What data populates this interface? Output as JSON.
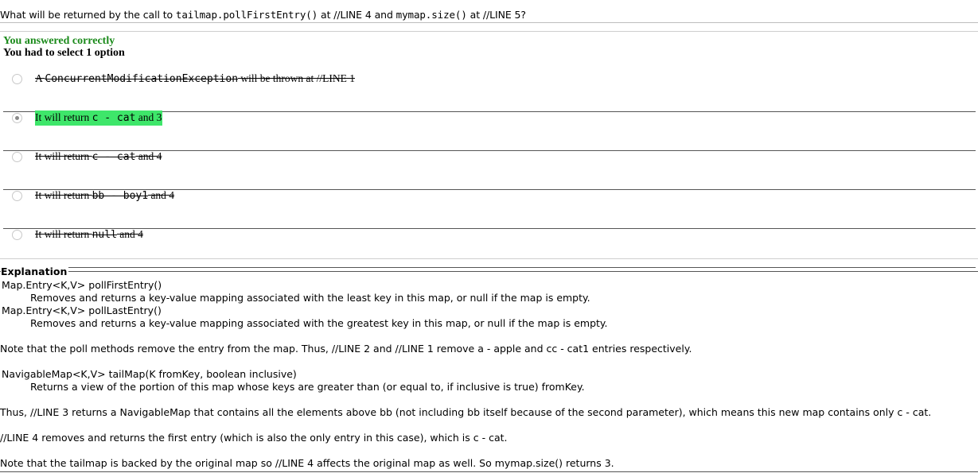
{
  "question": {
    "pre": "What will be returned by the call to ",
    "code1": "tailmap.pollFirstEntry()",
    "mid": " at //LINE 4 and ",
    "code2": "mymap.size()",
    "post": " at //LINE 5?"
  },
  "result": {
    "status": "You answered correctly",
    "instruction": "You had to select 1 option"
  },
  "options": [
    {
      "pre": "A ",
      "code": "ConcurrentModificationException",
      "post": " will be thrown at //LINE 1",
      "selected": false
    },
    {
      "pre": "It will return ",
      "code": "c - cat",
      "post": " and 3",
      "selected": true
    },
    {
      "pre": "It will return ",
      "code": "c - cat",
      "post": " and 4",
      "selected": false
    },
    {
      "pre": "It will return ",
      "code": "bb - boy1",
      "post": " and 4",
      "selected": false
    },
    {
      "pre": "It will return ",
      "code": "null",
      "post": " and 4",
      "selected": false
    }
  ],
  "explanation": {
    "title": "Explanation",
    "lines": [
      "Map.Entry<K,V> pollFirstEntry()",
      "Removes and returns a key-value mapping associated with the least key in this map, or null if the map is empty.",
      "Map.Entry<K,V> pollLastEntry()",
      "Removes and returns a key-value mapping associated with the greatest key in this map, or null if the map is empty.",
      "Note that the poll methods remove the entry from the map.  Thus, //LINE 2 and //LINE 1 remove a - apple and cc - cat1 entries respectively.",
      "NavigableMap<K,V> tailMap(K fromKey, boolean inclusive)",
      "Returns a view of the portion of this map whose keys are greater than (or equal to, if inclusive is true) fromKey.",
      "Thus,  //LINE 3 returns a NavigableMap that contains all the elements above bb (not including bb itself because of the second parameter), which means this new map contains only c - cat.",
      "//LINE 4 removes and returns the first entry (which is also the only entry in this case), which is c - cat.",
      "Note that the tailmap is backed by the original map so //LINE 4 affects the original map as well. So mymap.size() returns 3."
    ]
  },
  "colors": {
    "correct_text": "#1a8a1a",
    "selected_highlight": "#3ee66a"
  }
}
